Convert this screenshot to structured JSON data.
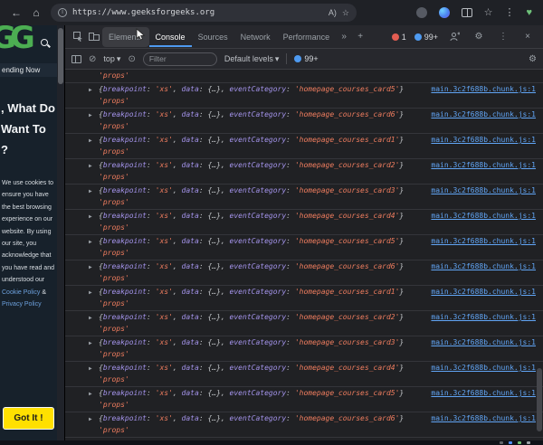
{
  "browser": {
    "url": "https://www.geeksforgeeks.org"
  },
  "icons": {
    "back": "←",
    "home": "⌂",
    "site_info": "i",
    "read_aloud": "A)",
    "bookmark_star": "☆",
    "favorites_star": "☆",
    "heart": "♥",
    "more_tabs": "»",
    "add_tab": "+",
    "close": "×",
    "overflow": "⋮",
    "gear": "⚙",
    "caret_down": "▾",
    "clear": "⊘",
    "eye": "⊙",
    "expand": "▶"
  },
  "page": {
    "logo": "GG",
    "trending_label": "ending Now",
    "headline_line1": ", What Do",
    "headline_line2": "Want To",
    "headline_line3": "?",
    "cookie_text_1": "We use cookies to ensure you have the best browsing experience on our website. By using our site, you acknowledge that you have read and understood our ",
    "cookie_link_1": "Cookie Policy",
    "cookie_text_2": " & ",
    "cookie_link_2": "Privacy Policy",
    "got_it_label": "Got It !"
  },
  "devtools": {
    "tabs": [
      "Elements",
      "Console",
      "Sources",
      "Network",
      "Performance"
    ],
    "badges": {
      "errors": "1",
      "issues": "99+"
    },
    "toolbar": {
      "context": "top",
      "filter_placeholder": "Filter",
      "levels_label": "Default levels",
      "issues_count": "99+"
    },
    "console": {
      "partial_top": "'props'",
      "parts": {
        "open": "{",
        "key1": "breakpoint",
        "sep": ": ",
        "val1": "'xs'",
        "comma": ", ",
        "key2": "data",
        "val2": "{…}",
        "key3": "eventCategory",
        "close": "}",
        "tail": "'props'"
      },
      "entries": [
        "homepage_courses_card5",
        "homepage_courses_card6",
        "homepage_courses_card1",
        "homepage_courses_card2",
        "homepage_courses_card3",
        "homepage_courses_card4",
        "homepage_courses_card5",
        "homepage_courses_card6",
        "homepage_courses_card1",
        "homepage_courses_card2",
        "homepage_courses_card3",
        "homepage_courses_card4",
        "homepage_courses_card5",
        "homepage_courses_card6"
      ],
      "source_link": "main.3c2f688b.chunk.js:1",
      "prompt": ">"
    }
  }
}
